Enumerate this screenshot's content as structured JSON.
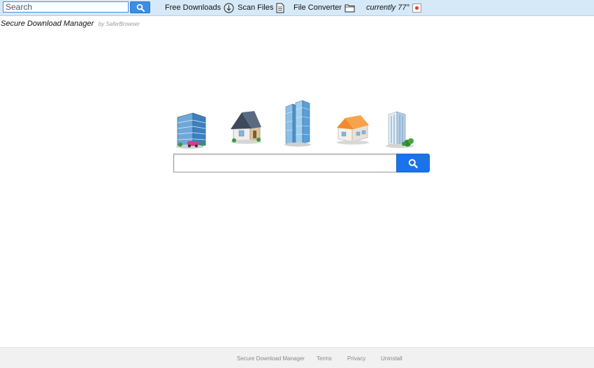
{
  "toolbar": {
    "search_placeholder": "Search",
    "links": {
      "free_downloads": "Free Downloads",
      "scan_files": "Scan Files",
      "file_converter": "File Converter"
    },
    "weather": "currently 77°"
  },
  "brand": {
    "name": "Secure Download Manager",
    "by": "by SaferBrowser"
  },
  "main_search": {
    "value": ""
  },
  "footer": {
    "links": [
      "Secure Download Manager",
      "Terms",
      "Privacy",
      "Uninstall"
    ]
  },
  "colors": {
    "toolbar_bg": "#d6e9f8",
    "search_button": "#1a73e8",
    "footer_bg": "#f1f1f1"
  },
  "icons": [
    "search-icon",
    "download-icon",
    "document-icon",
    "folder-icon",
    "weather-icon",
    "office-building-icon",
    "house-icon",
    "skyscraper-icon",
    "orange-roof-house-icon",
    "tower-icon"
  ]
}
